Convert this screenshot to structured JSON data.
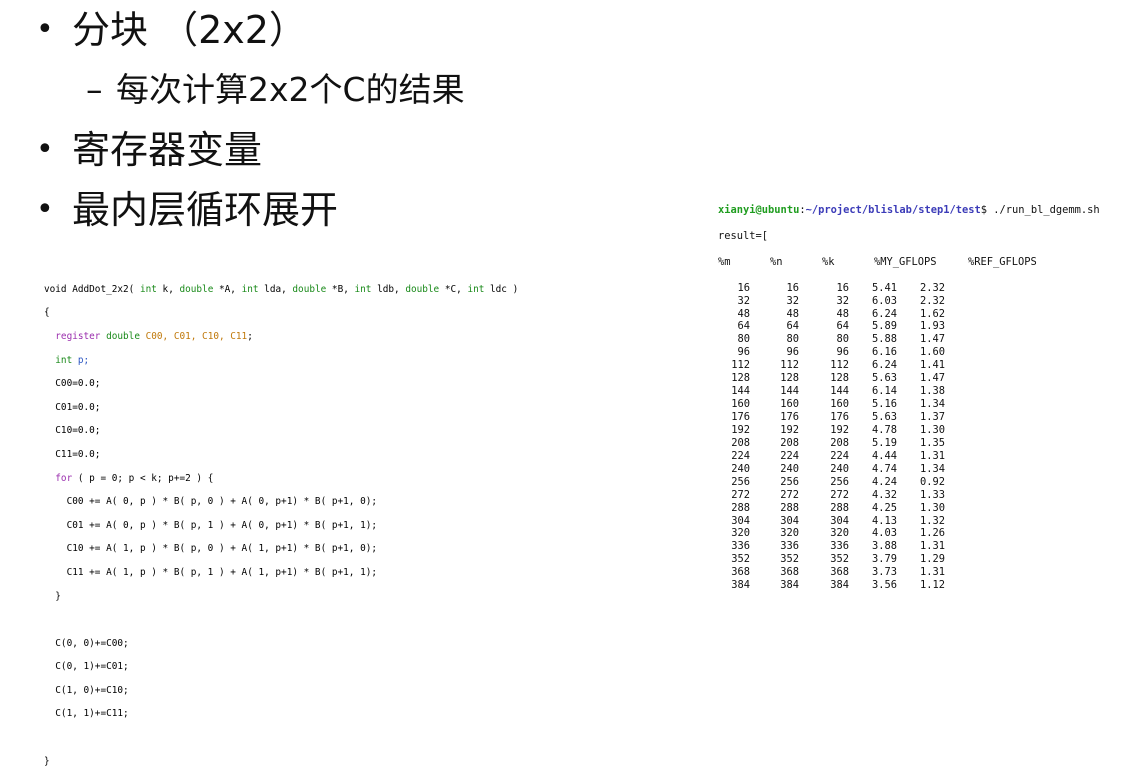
{
  "bullets": [
    {
      "marker": "•",
      "text": "分块 （2x2）"
    },
    {
      "marker": "•",
      "text": "寄存器变量"
    },
    {
      "marker": "•",
      "text": "最内层循环展开"
    }
  ],
  "sub_bullet": {
    "marker": "–",
    "text": "每次计算2x2个C的结果"
  },
  "code": {
    "sig_void": "void ",
    "sig_name": "AddDot_2x2( ",
    "sig_int1": "int",
    "sig_k": " k, ",
    "sig_double1": "double",
    "sig_A": " *A, ",
    "sig_int2": "int",
    "sig_lda": " lda, ",
    "sig_double2": "double",
    "sig_B": " *B, ",
    "sig_int3": "int",
    "sig_ldb": " ldb, ",
    "sig_double3": "double",
    "sig_C": " *C, ",
    "sig_int4": "int",
    "sig_ldc": " ldc )",
    "open_brace": "{",
    "register_kw": "  register",
    "register_type": " double ",
    "register_vars": "C00, C01, C10, C11",
    "register_end": ";",
    "int_kw": "  int",
    "int_var": " p;",
    "init_lines": [
      "  C00=0.0;",
      "  C01=0.0;",
      "  C10=0.0;",
      "  C11=0.0;"
    ],
    "for_kw": "  for",
    "for_rest": " ( p = 0; p < k; p+=2 ) {",
    "body_lines": [
      "    C00 += A( 0, p ) * B( p, 0 ) + A( 0, p+1) * B( p+1, 0);",
      "    C01 += A( 0, p ) * B( p, 1 ) + A( 0, p+1) * B( p+1, 1);",
      "    C10 += A( 1, p ) * B( p, 0 ) + A( 1, p+1) * B( p+1, 0);",
      "    C11 += A( 1, p ) * B( p, 1 ) + A( 1, p+1) * B( p+1, 1);"
    ],
    "for_close": "  }",
    "store_lines": [
      "  C(0, 0)+=C00;",
      "  C(0, 1)+=C01;",
      "  C(1, 0)+=C10;",
      "  C(1, 1)+=C11;"
    ],
    "close_brace": "}"
  },
  "terminal": {
    "user": "xianyi@ubuntu",
    "sep": ":",
    "path": "~/project/blislab/step1/test",
    "prompt_end": "$ ",
    "command": "./run_bl_dgemm.sh",
    "result_line": "result=[",
    "headers": [
      "%m",
      "%n",
      "%k",
      "%MY_GFLOPS",
      "%REF_GFLOPS"
    ],
    "rows": [
      [
        "16",
        "16",
        "16",
        "5.41",
        "2.32"
      ],
      [
        "32",
        "32",
        "32",
        "6.03",
        "2.32"
      ],
      [
        "48",
        "48",
        "48",
        "6.24",
        "1.62"
      ],
      [
        "64",
        "64",
        "64",
        "5.89",
        "1.93"
      ],
      [
        "80",
        "80",
        "80",
        "5.88",
        "1.47"
      ],
      [
        "96",
        "96",
        "96",
        "6.16",
        "1.60"
      ],
      [
        "112",
        "112",
        "112",
        "6.24",
        "1.41"
      ],
      [
        "128",
        "128",
        "128",
        "5.63",
        "1.47"
      ],
      [
        "144",
        "144",
        "144",
        "6.14",
        "1.38"
      ],
      [
        "160",
        "160",
        "160",
        "5.16",
        "1.34"
      ],
      [
        "176",
        "176",
        "176",
        "5.63",
        "1.37"
      ],
      [
        "192",
        "192",
        "192",
        "4.78",
        "1.30"
      ],
      [
        "208",
        "208",
        "208",
        "5.19",
        "1.35"
      ],
      [
        "224",
        "224",
        "224",
        "4.44",
        "1.31"
      ],
      [
        "240",
        "240",
        "240",
        "4.74",
        "1.34"
      ],
      [
        "256",
        "256",
        "256",
        "4.24",
        "0.92"
      ],
      [
        "272",
        "272",
        "272",
        "4.32",
        "1.33"
      ],
      [
        "288",
        "288",
        "288",
        "4.25",
        "1.30"
      ],
      [
        "304",
        "304",
        "304",
        "4.13",
        "1.32"
      ],
      [
        "320",
        "320",
        "320",
        "4.03",
        "1.26"
      ],
      [
        "336",
        "336",
        "336",
        "3.88",
        "1.31"
      ],
      [
        "352",
        "352",
        "352",
        "3.79",
        "1.29"
      ],
      [
        "368",
        "368",
        "368",
        "3.73",
        "1.31"
      ],
      [
        "384",
        "384",
        "384",
        "3.56",
        "1.12"
      ]
    ]
  }
}
